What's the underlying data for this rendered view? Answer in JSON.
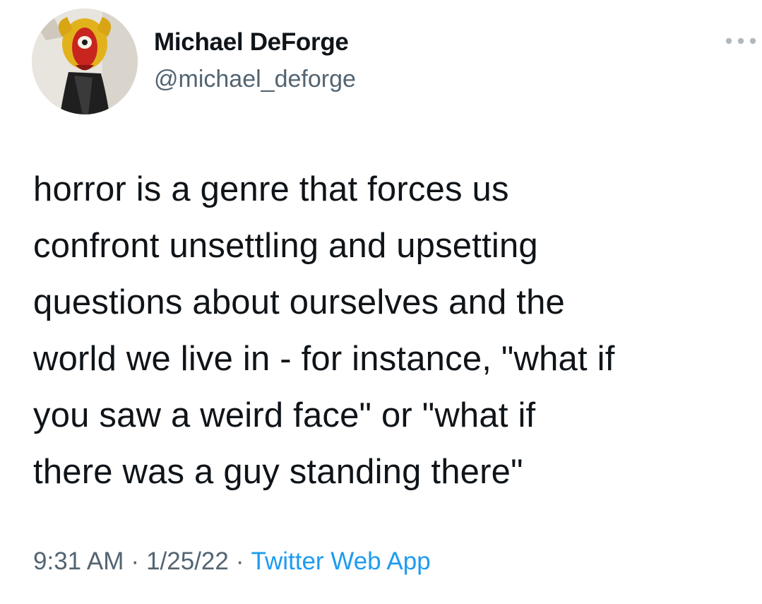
{
  "author": {
    "display_name": "Michael DeForge",
    "handle": "@michael_deforge",
    "avatar_icon": "avatar-photo"
  },
  "more_icon": "more-dots-icon",
  "tweet": {
    "text": "horror is a genre that forces us\nconfront unsettling and upsetting\nquestions about ourselves and the\nworld we live in - for instance, \"what if\nyou saw a weird face\" or \"what if\nthere was a guy standing there\""
  },
  "meta": {
    "time": "9:31 AM",
    "separator": "·",
    "date": "1/25/22",
    "source": "Twitter Web App"
  },
  "colors": {
    "text": "#0f1419",
    "secondary": "#536471",
    "link": "#1d9bf0"
  }
}
